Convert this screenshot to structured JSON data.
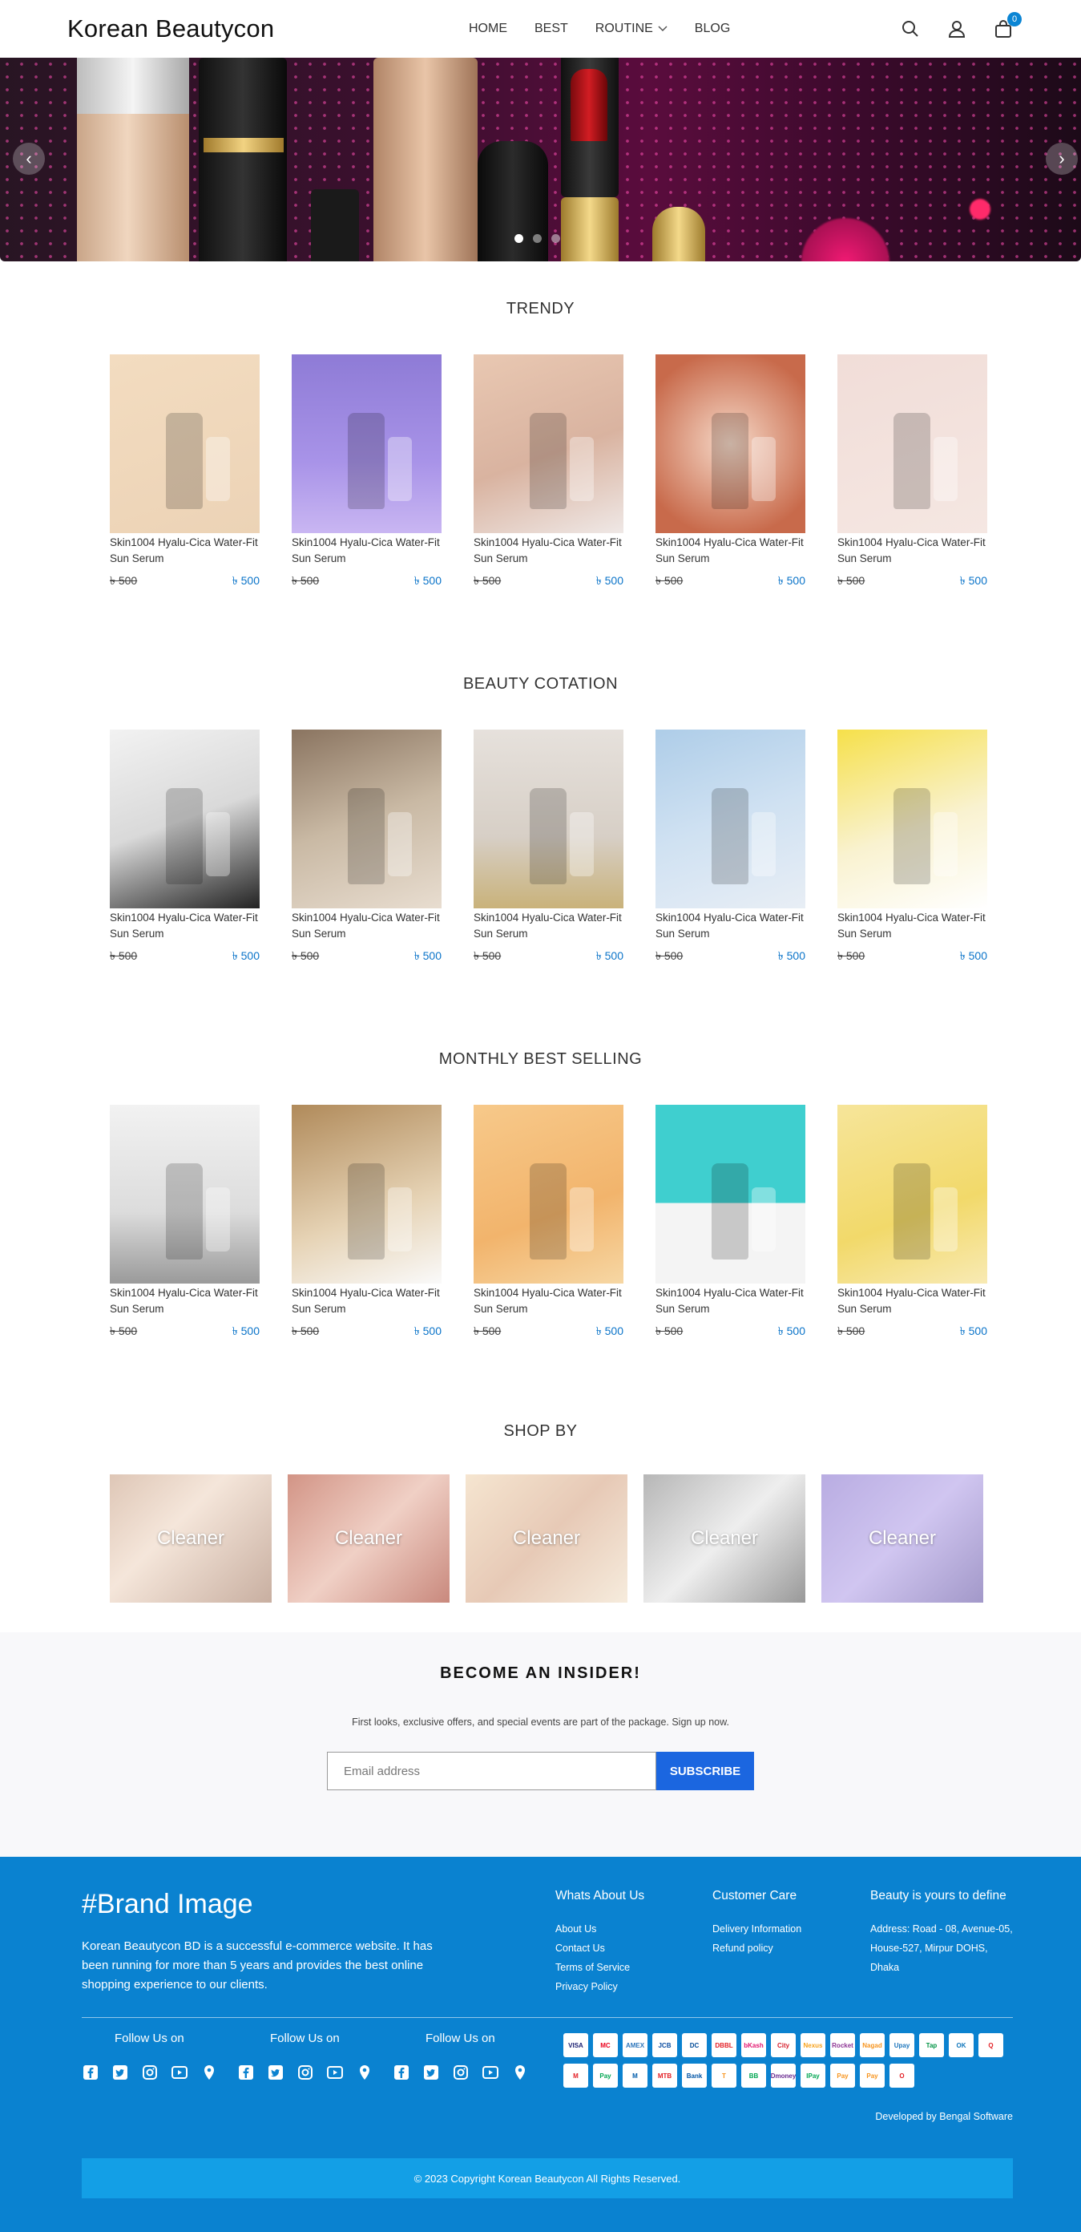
{
  "header": {
    "logo": "Korean Beautycon",
    "nav": [
      {
        "label": "HOME"
      },
      {
        "label": "BEST"
      },
      {
        "label": "ROUTINE"
      },
      {
        "label": "BLOG"
      }
    ],
    "cart_count": "0"
  },
  "hero": {
    "slides": 3,
    "active_slide": 1
  },
  "sections": [
    {
      "title": "TRENDY",
      "products": [
        {
          "name": "Skin1004 Hyalu-Cica Water-Fit Sun Serum",
          "old_price": "৳ 500",
          "price": "৳ 500",
          "image": "cosmetics-brushes"
        },
        {
          "name": "Skin1004 Hyalu-Cica Water-Fit Sun Serum",
          "old_price": "৳ 500",
          "price": "৳ 500",
          "image": "sponges-purple"
        },
        {
          "name": "Skin1004 Hyalu-Cica Water-Fit Sun Serum",
          "old_price": "৳ 500",
          "price": "৳ 500",
          "image": "bottles-tray"
        },
        {
          "name": "Skin1004 Hyalu-Cica Water-Fit Sun Serum",
          "old_price": "৳ 500",
          "price": "৳ 500",
          "image": "lipstick-palette"
        },
        {
          "name": "Skin1004 Hyalu-Cica Water-Fit Sun Serum",
          "old_price": "৳ 500",
          "price": "৳ 500",
          "image": "flatlay-makeup"
        }
      ]
    },
    {
      "title": "BEAUTY COTATION",
      "products": [
        {
          "name": "Skin1004 Hyalu-Cica Water-Fit Sun Serum",
          "old_price": "৳ 500",
          "price": "৳ 500",
          "image": "makeup-brushes-white"
        },
        {
          "name": "Skin1004 Hyalu-Cica Water-Fit Sun Serum",
          "old_price": "৳ 500",
          "price": "৳ 500",
          "image": "crystal-ball"
        },
        {
          "name": "Skin1004 Hyalu-Cica Water-Fit Sun Serum",
          "old_price": "৳ 500",
          "price": "৳ 500",
          "image": "toner-bottle"
        },
        {
          "name": "Skin1004 Hyalu-Cica Water-Fit Sun Serum",
          "old_price": "৳ 500",
          "price": "৳ 500",
          "image": "serum-blue"
        },
        {
          "name": "Skin1004 Hyalu-Cica Water-Fit Sun Serum",
          "old_price": "৳ 500",
          "price": "৳ 500",
          "image": "cream-jar-yellow"
        }
      ]
    },
    {
      "title": "MONTHLY BEST SELLING",
      "products": [
        {
          "name": "Skin1004 Hyalu-Cica Water-Fit Sun Serum",
          "old_price": "৳ 500",
          "price": "৳ 500",
          "image": "cosrx-serum"
        },
        {
          "name": "Skin1004 Hyalu-Cica Water-Fit Sun Serum",
          "old_price": "৳ 500",
          "price": "৳ 500",
          "image": "sunscreen-tube"
        },
        {
          "name": "Skin1004 Hyalu-Cica Water-Fit Sun Serum",
          "old_price": "৳ 500",
          "price": "৳ 500",
          "image": "woman-bottles"
        },
        {
          "name": "Skin1004 Hyalu-Cica Water-Fit Sun Serum",
          "old_price": "৳ 500",
          "price": "৳ 500",
          "image": "green-serum-teal"
        },
        {
          "name": "Skin1004 Hyalu-Cica Water-Fit Sun Serum",
          "old_price": "৳ 500",
          "price": "৳ 500",
          "image": "cream-jar-niacinamide"
        }
      ]
    }
  ],
  "shop_by": {
    "title": "SHOP BY",
    "cards": [
      {
        "label": "Cleaner"
      },
      {
        "label": "Cleaner"
      },
      {
        "label": "Cleaner"
      },
      {
        "label": "Cleaner"
      },
      {
        "label": "Cleaner"
      }
    ]
  },
  "newsletter": {
    "title": "BECOME AN INSIDER!",
    "subtitle": "First looks, exclusive offers, and special events are part of the package. Sign up now.",
    "placeholder": "Email address",
    "button": "SUBSCRIBE"
  },
  "footer": {
    "brand": "#Brand Image",
    "description": "Korean Beautycon BD is a successful e-commerce website. It has been running for more than 5 years and provides the best online shopping experience to our clients.",
    "col1": {
      "title": "Whats About Us",
      "links": [
        "About Us",
        "Contact Us",
        "Terms of Service",
        "Privacy Policy"
      ]
    },
    "col2": {
      "title": "Customer Care",
      "links": [
        "Delivery Information",
        "Refund policy"
      ]
    },
    "col3": {
      "title": "Beauty is yours to define",
      "address": "Address: Road - 08, Avenue-05, House-527, Mirpur DOHS, Dhaka"
    },
    "follow": [
      "Follow Us on",
      "Follow Us on",
      "Follow Us on"
    ],
    "payments": [
      "VISA",
      "MC",
      "AMEX",
      "JCB",
      "DC",
      "DBBL",
      "bKash",
      "City",
      "Nexus",
      "Rocket",
      "Nagad",
      "Upay",
      "Tap",
      "OK",
      "Q",
      "M",
      "Pay",
      "M",
      "MTB",
      "Bank",
      "T",
      "BB",
      "Dmoney",
      "IPay",
      "Pay",
      "Pay",
      "O"
    ],
    "developer": "Developed by Bengal Software",
    "copyright": "© 2023 Copyright Korean Beautycon All Rights Reserved.",
    "colors": {
      "footer_bg": "#0a82d0",
      "copyright_bg": "#139fe6",
      "accent": "#1b66e0",
      "price": "#0b74c9"
    }
  }
}
